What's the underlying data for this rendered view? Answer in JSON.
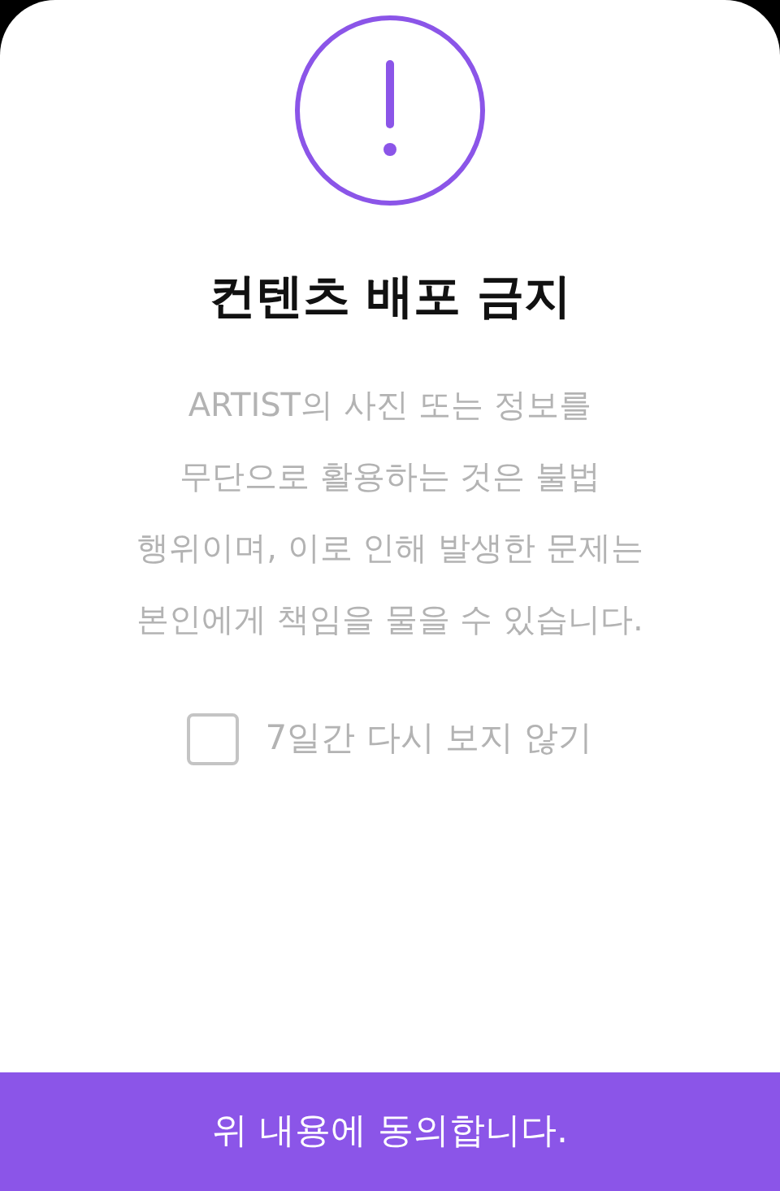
{
  "dialog": {
    "title": "컨텐츠 배포 금지",
    "message": "ARTIST의 사진 또는 정보를 무단으로 활용하는 것은 불법 행위이며, 이로 인해 발생한 문제는 본인에게 책임을 물을 수 있습니다.",
    "checkbox": {
      "label": "7일간 다시 보지 않기",
      "checked": false
    },
    "button": "위 내용에 동의합니다."
  }
}
